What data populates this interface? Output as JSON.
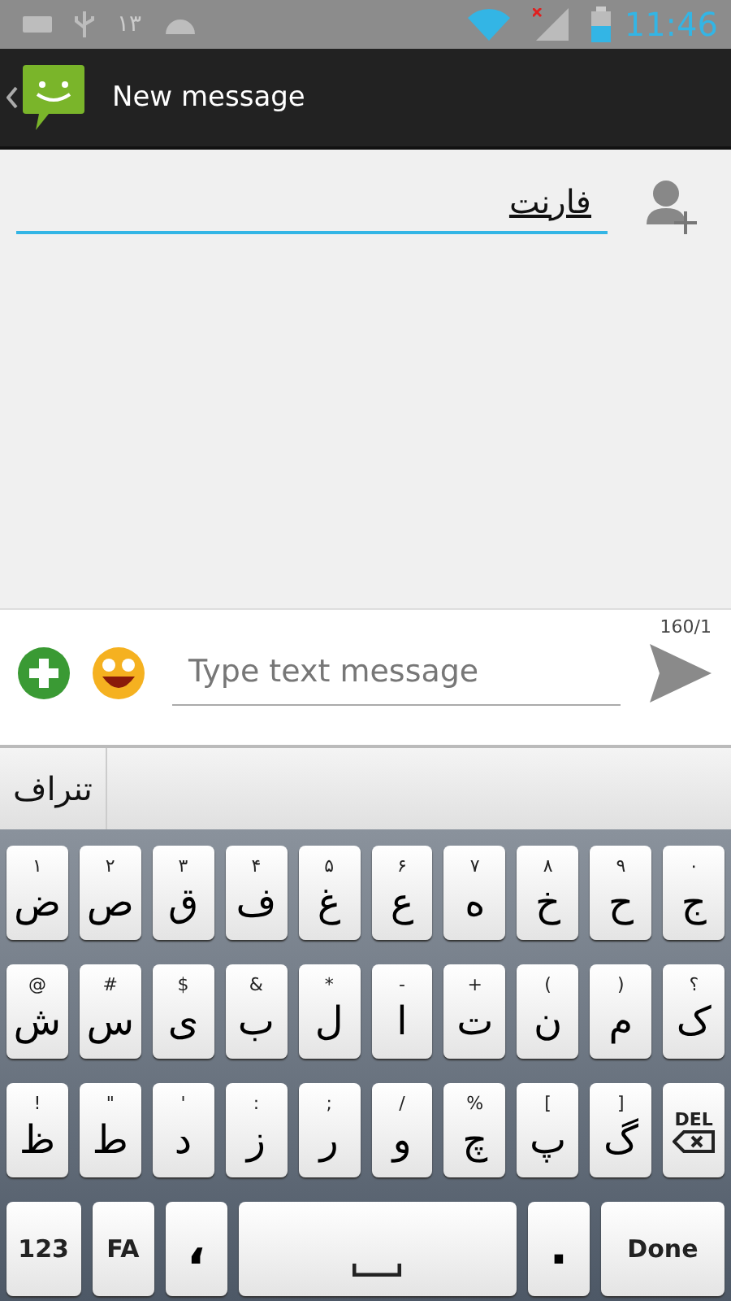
{
  "status_bar": {
    "notification_text": "١٣",
    "time": "11:46"
  },
  "action_bar": {
    "title": "New message"
  },
  "recipient": {
    "value": "فارنت"
  },
  "compose": {
    "counter": "160/1",
    "placeholder": "Type text message"
  },
  "suggestions": [
    "تنراف"
  ],
  "keyboard": {
    "rows": [
      [
        {
          "kind": "char",
          "label": "ض",
          "hint": "۱"
        },
        {
          "kind": "char",
          "label": "ص",
          "hint": "۲"
        },
        {
          "kind": "char",
          "label": "ق",
          "hint": "۳"
        },
        {
          "kind": "char",
          "label": "ف",
          "hint": "۴"
        },
        {
          "kind": "char",
          "label": "غ",
          "hint": "۵"
        },
        {
          "kind": "char",
          "label": "ع",
          "hint": "۶"
        },
        {
          "kind": "char",
          "label": "ه",
          "hint": "۷"
        },
        {
          "kind": "char",
          "label": "خ",
          "hint": "۸"
        },
        {
          "kind": "char",
          "label": "ح",
          "hint": "۹"
        },
        {
          "kind": "char",
          "label": "ج",
          "hint": "۰"
        }
      ],
      [
        {
          "kind": "char",
          "label": "ش",
          "hint": "@"
        },
        {
          "kind": "char",
          "label": "س",
          "hint": "#"
        },
        {
          "kind": "char",
          "label": "ی",
          "hint": "$"
        },
        {
          "kind": "char",
          "label": "ب",
          "hint": "&"
        },
        {
          "kind": "char",
          "label": "ل",
          "hint": "*"
        },
        {
          "kind": "char",
          "label": "ا",
          "hint": "-"
        },
        {
          "kind": "char",
          "label": "ت",
          "hint": "+"
        },
        {
          "kind": "char",
          "label": "ن",
          "hint": "("
        },
        {
          "kind": "char",
          "label": "م",
          "hint": ")"
        },
        {
          "kind": "char",
          "label": "ک",
          "hint": "؟"
        }
      ],
      [
        {
          "kind": "char",
          "label": "ظ",
          "hint": "!"
        },
        {
          "kind": "char",
          "label": "ط",
          "hint": "\""
        },
        {
          "kind": "char",
          "label": "د",
          "hint": "'"
        },
        {
          "kind": "char",
          "label": "ز",
          "hint": ":"
        },
        {
          "kind": "char",
          "label": "ر",
          "hint": ";"
        },
        {
          "kind": "char",
          "label": "و",
          "hint": "/"
        },
        {
          "kind": "char",
          "label": "چ",
          "hint": "%"
        },
        {
          "kind": "char",
          "label": "پ",
          "hint": "["
        },
        {
          "kind": "char",
          "label": "گ",
          "hint": "]"
        },
        {
          "kind": "delete",
          "label": "DEL"
        }
      ]
    ],
    "bottom_row": [
      {
        "kind": "mode",
        "label": "123"
      },
      {
        "kind": "mode",
        "label": "FA"
      },
      {
        "kind": "char",
        "label": "،"
      },
      {
        "kind": "space"
      },
      {
        "kind": "char",
        "label": "."
      },
      {
        "kind": "done",
        "label": "Done"
      }
    ]
  }
}
